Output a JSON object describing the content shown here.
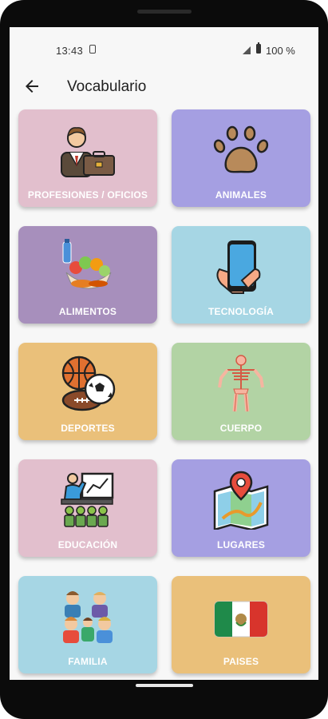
{
  "status": {
    "time": "13:43",
    "battery": "100 %"
  },
  "header": {
    "title": "Vocabulario"
  },
  "categories": [
    {
      "label": "PROFESIONES / OFICIOS",
      "icon": "businessman-briefcase-icon",
      "color": "#e2bfcd"
    },
    {
      "label": "ANIMALES",
      "icon": "paw-icon",
      "color": "#a59fe2"
    },
    {
      "label": "ALIMENTOS",
      "icon": "food-basket-icon",
      "color": "#a78fbc"
    },
    {
      "label": "TECNOLOGÍA",
      "icon": "smartphone-hand-icon",
      "color": "#a6d6e4"
    },
    {
      "label": "DEPORTES",
      "icon": "sports-balls-icon",
      "color": "#eac07a"
    },
    {
      "label": "CUERPO",
      "icon": "skeleton-body-icon",
      "color": "#b2d3a4"
    },
    {
      "label": "EDUCACIÓN",
      "icon": "classroom-icon",
      "color": "#e2bfcd"
    },
    {
      "label": "LUGARES",
      "icon": "map-pin-icon",
      "color": "#a59fe2"
    },
    {
      "label": "FAMILIA",
      "icon": "family-icon",
      "color": "#a6d6e4"
    },
    {
      "label": "PAISES",
      "icon": "mexico-flag-icon",
      "color": "#eac07a"
    }
  ]
}
